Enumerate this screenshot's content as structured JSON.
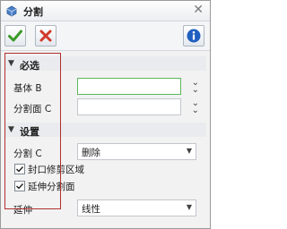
{
  "window": {
    "title": "分割"
  },
  "sections": {
    "required": {
      "label": "必选"
    },
    "settings": {
      "label": "设置"
    }
  },
  "fields": {
    "base": {
      "label": "基体 B",
      "value": ""
    },
    "split_face": {
      "label": "分割面 C",
      "value": ""
    },
    "split_mode": {
      "label": "分割 C",
      "value": "删除"
    },
    "extend": {
      "label": "延伸",
      "value": "线性"
    }
  },
  "checkboxes": {
    "seal_trim": {
      "label": "封口修剪区域",
      "checked": true
    },
    "extend_split_face": {
      "label": "延伸分割面",
      "checked": true
    }
  },
  "icons": {
    "ok": "checkmark-icon",
    "cancel": "x-icon",
    "info": "info-icon",
    "close": "close-icon"
  },
  "colors": {
    "ok_green": "#3a9a2a",
    "cancel_red": "#d03a2a",
    "info_blue": "#1f5fbf",
    "active_border": "#5cb85c"
  }
}
